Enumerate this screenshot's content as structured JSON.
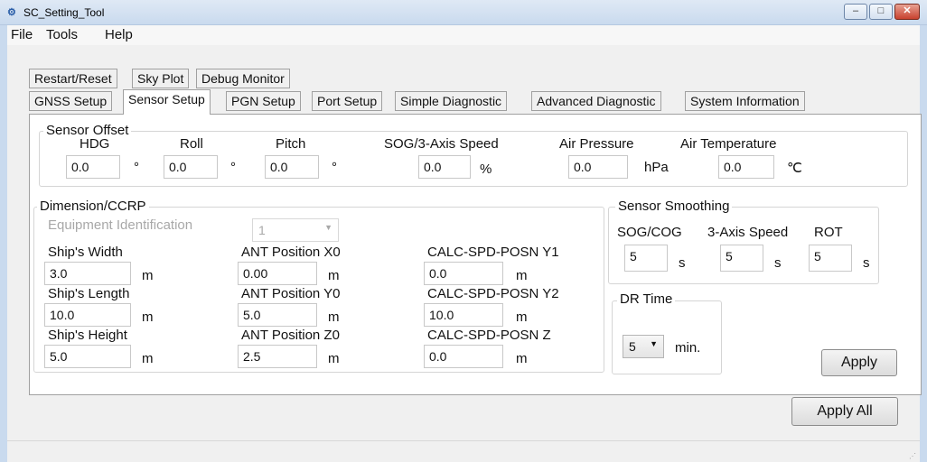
{
  "window": {
    "title": "SC_Setting_Tool"
  },
  "menu": [
    "File",
    "Tools",
    "Help"
  ],
  "tabs_row1": [
    "Restart/Reset",
    "Sky Plot",
    "Debug Monitor"
  ],
  "tabs_row2": [
    "GNSS Setup",
    "Sensor Setup",
    "PGN Setup",
    "Port Setup",
    "Simple Diagnostic",
    "Advanced Diagnostic",
    "System Information"
  ],
  "active_tab": "Sensor Setup",
  "sensor_offset": {
    "title": "Sensor Offset",
    "hdg_label": "HDG",
    "hdg_value": "0.0",
    "hdg_unit": "°",
    "roll_label": "Roll",
    "roll_value": "0.0",
    "roll_unit": "°",
    "pitch_label": "Pitch",
    "pitch_value": "0.0",
    "pitch_unit": "°",
    "sog_label": "SOG/3-Axis Speed",
    "sog_value": "0.0",
    "sog_unit": "%",
    "air_pressure_label": "Air Pressure",
    "air_pressure_value": "0.0",
    "air_pressure_unit": "hPa",
    "air_temp_label": "Air Temperature",
    "air_temp_value": "0.0",
    "air_temp_unit": "℃"
  },
  "dimension": {
    "title": "Dimension/CCRP",
    "equipment_label": "Equipment Identification",
    "equipment_value": "1",
    "width_label": "Ship's Width",
    "width_value": "3.0",
    "width_unit": "m",
    "length_label": "Ship's Length",
    "length_value": "10.0",
    "length_unit": "m",
    "height_label": "Ship's Height",
    "height_value": "5.0",
    "height_unit": "m",
    "antx_label": "ANT Position X0",
    "antx_value": "0.00",
    "antx_unit": "m",
    "anty_label": "ANT Position Y0",
    "anty_value": "5.0",
    "anty_unit": "m",
    "antz_label": "ANT Position Z0",
    "antz_value": "2.5",
    "antz_unit": "m",
    "calc_y1_label": "CALC-SPD-POSN Y1",
    "calc_y1_value": "0.0",
    "calc_y1_unit": "m",
    "calc_y2_label": "CALC-SPD-POSN Y2",
    "calc_y2_value": "10.0",
    "calc_y2_unit": "m",
    "calc_z_label": "CALC-SPD-POSN Z",
    "calc_z_value": "0.0",
    "calc_z_unit": "m"
  },
  "smoothing": {
    "title": "Sensor Smoothing",
    "sogcog_label": "SOG/COG",
    "sogcog_value": "5",
    "sogcog_unit": "s",
    "speed_label": "3-Axis Speed",
    "speed_value": "5",
    "speed_unit": "s",
    "rot_label": "ROT",
    "rot_value": "5",
    "rot_unit": "s"
  },
  "dr_time": {
    "title": "DR Time",
    "value": "5",
    "unit": "min."
  },
  "buttons": {
    "apply": "Apply",
    "apply_all": "Apply All"
  }
}
